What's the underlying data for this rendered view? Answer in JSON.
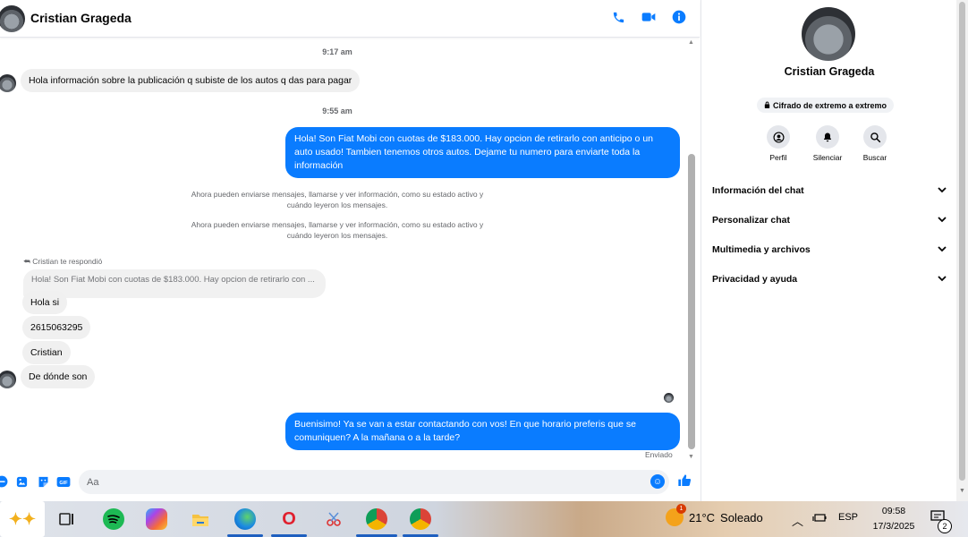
{
  "header": {
    "contact_name": "Cristian Grageda"
  },
  "messages": {
    "time1": "9:17 am",
    "in1": "Hola información sobre la publicación q subiste de los autos q das para pagar",
    "time2": "9:55 am",
    "out1": "Hola! Son Fiat Mobi con cuotas de $183.000. Hay opcion de retirarlo con anticipo o un auto usado! Tambien tenemos otros autos. Dejame tu numero para enviarte toda la información",
    "system1": "Ahora pueden enviarse mensajes, llamarse y ver información, como su estado activo y cuándo leyeron los mensajes.",
    "system2": "Ahora pueden enviarse mensajes, llamarse y ver información, como su estado activo y cuándo leyeron los mensajes.",
    "replied_label": "Cristian te respondió",
    "reply_quote": "Hola! Son Fiat Mobi con cuotas de $183.000. Hay opcion de retirarlo con ...",
    "in2": "Hola si",
    "in3": "2615063295",
    "in4": "Cristian",
    "in5": "De dónde son",
    "out2": "Buenisimo! Ya se van a estar contactando con vos! En que horario preferis que se comuniquen? A la mañana o a la tarde?",
    "sent_status": "Enviado"
  },
  "composer": {
    "placeholder": "Aa"
  },
  "info_panel": {
    "name": "Cristian Grageda",
    "encryption": "Cifrado de extremo a extremo",
    "actions": [
      "Perfil",
      "Silenciar",
      "Buscar"
    ],
    "sections": [
      "Información del chat",
      "Personalizar chat",
      "Multimedia y archivos",
      "Privacidad y ayuda"
    ]
  },
  "taskbar": {
    "weather_temp": "21°C",
    "weather_text": "Soleado",
    "weather_badge": "1",
    "language": "ESP",
    "time": "09:58",
    "date": "17/3/2025",
    "notification_count": "2"
  },
  "colors": {
    "accent": "#0a7cff",
    "incoming_bubble": "#f0f0f0"
  }
}
